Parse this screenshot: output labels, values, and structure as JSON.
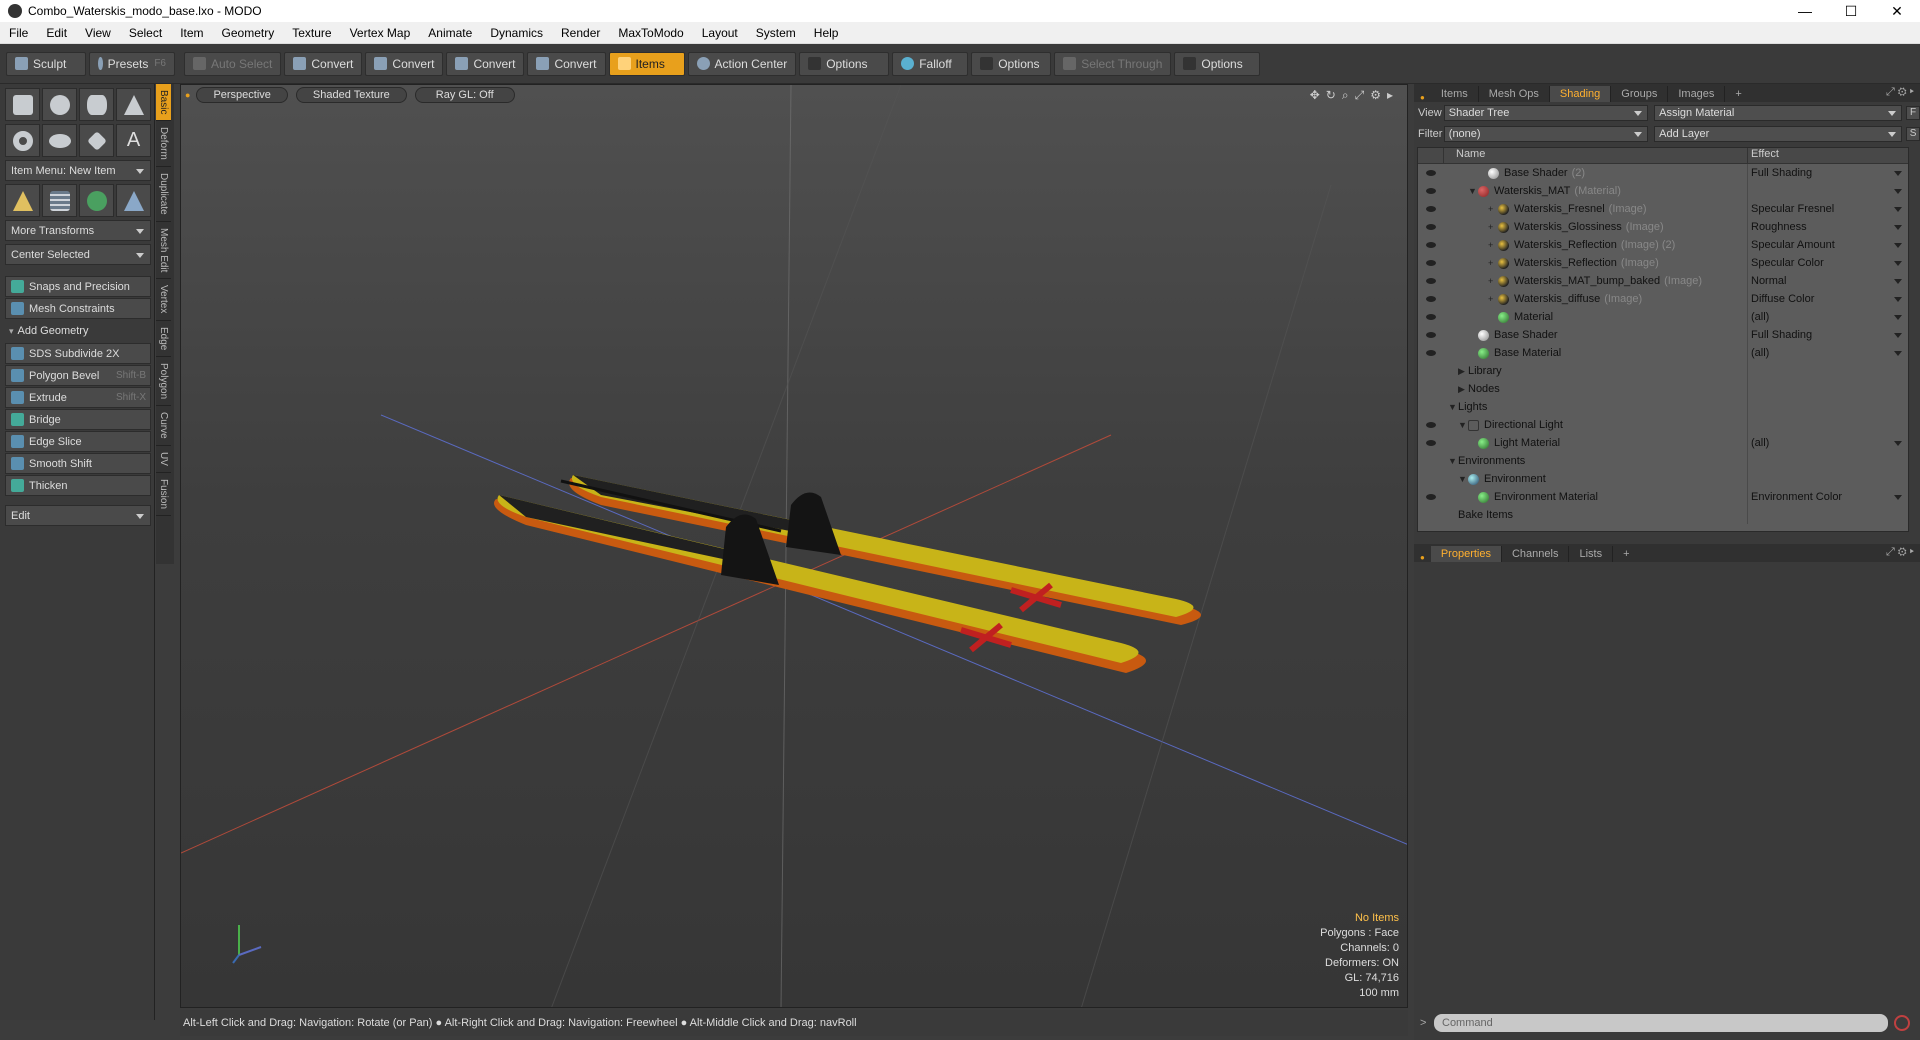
{
  "window": {
    "title": "Combo_Waterskis_modo_base.lxo - MODO",
    "min": "—",
    "max": "☐",
    "close": "✕"
  },
  "menu": [
    "File",
    "Edit",
    "View",
    "Select",
    "Item",
    "Geometry",
    "Texture",
    "Vertex Map",
    "Animate",
    "Dynamics",
    "Render",
    "MaxToModo",
    "Layout",
    "System",
    "Help"
  ],
  "toolbar": {
    "sculpt": "Sculpt",
    "presets": "Presets",
    "presets_key": "F6",
    "auto_select": "Auto Select",
    "convert": "Convert",
    "items": "Items",
    "action_center": "Action Center",
    "options": "Options",
    "falloff": "Falloff",
    "select_through": "Select Through"
  },
  "left": {
    "item_menu": "Item Menu: New Item",
    "more_transforms": "More Transforms",
    "center_selected": "Center Selected",
    "snaps": "Snaps and Precision",
    "mesh_constraints": "Mesh Constraints",
    "add_geometry": "Add Geometry",
    "tools": [
      {
        "label": "SDS Subdivide 2X",
        "key": ""
      },
      {
        "label": "Polygon Bevel",
        "key": "Shift-B"
      },
      {
        "label": "Extrude",
        "key": "Shift-X"
      },
      {
        "label": "Bridge",
        "key": ""
      },
      {
        "label": "Edge Slice",
        "key": ""
      },
      {
        "label": "Smooth Shift",
        "key": ""
      },
      {
        "label": "Thicken",
        "key": ""
      }
    ],
    "edit": "Edit"
  },
  "vtabs": [
    "Basic",
    "Deform",
    "Duplicate",
    "Mesh Edit",
    "Vertex",
    "Edge",
    "Polygon",
    "Curve",
    "UV",
    "Fusion"
  ],
  "viewport": {
    "view": "Perspective",
    "shading": "Shaded Texture",
    "raygl": "Ray GL: Off",
    "info": {
      "items": "No Items",
      "polygons": "Polygons : Face",
      "channels": "Channels: 0",
      "deformers": "Deformers: ON",
      "gl": "GL: 74,716",
      "scale": "100 mm"
    }
  },
  "status": "Alt-Left Click and Drag: Navigation: Rotate (or Pan) ● Alt-Right Click and Drag: Navigation: Freewheel ● Alt-Middle Click and Drag: navRoll",
  "right": {
    "tabs": [
      "Items",
      "Mesh Ops",
      "Shading",
      "Groups",
      "Images",
      "+"
    ],
    "view_label": "View",
    "view_value": "Shader Tree",
    "assign": "Assign Material",
    "f": "F",
    "filter_label": "Filter",
    "filter_value": "(none)",
    "add_layer": "Add Layer",
    "s": "S",
    "col_name": "Name",
    "col_effect": "Effect",
    "rows": [
      {
        "name": "Base Shader",
        "sub": "(2)",
        "effect": "Full Shading",
        "indent": 3,
        "icon": "shader",
        "eye": true,
        "dd": true,
        "tri": ""
      },
      {
        "name": "Waterskis_MAT",
        "sub": "(Material)",
        "effect": "",
        "indent": 2,
        "icon": "mat",
        "eye": true,
        "dd": true,
        "tri": "▼"
      },
      {
        "name": "Waterskis_Fresnel",
        "sub": "(Image)",
        "effect": "Specular Fresnel",
        "indent": 4,
        "icon": "img",
        "eye": true,
        "dd": true,
        "tri": "+"
      },
      {
        "name": "Waterskis_Glossiness",
        "sub": "(Image)",
        "effect": "Roughness",
        "indent": 4,
        "icon": "img",
        "eye": true,
        "dd": true,
        "tri": "+"
      },
      {
        "name": "Waterskis_Reflection",
        "sub": "(Image) (2)",
        "effect": "Specular Amount",
        "indent": 4,
        "icon": "img",
        "eye": true,
        "dd": true,
        "tri": "+"
      },
      {
        "name": "Waterskis_Reflection",
        "sub": "(Image)",
        "effect": "Specular Color",
        "indent": 4,
        "icon": "img",
        "eye": true,
        "dd": true,
        "tri": "+"
      },
      {
        "name": "Waterskis_MAT_bump_baked",
        "sub": "(Image)",
        "effect": "Normal",
        "indent": 4,
        "icon": "img",
        "eye": true,
        "dd": true,
        "tri": "+"
      },
      {
        "name": "Waterskis_diffuse",
        "sub": "(Image)",
        "effect": "Diffuse Color",
        "indent": 4,
        "icon": "img",
        "eye": true,
        "dd": true,
        "tri": "+"
      },
      {
        "name": "Material",
        "sub": "",
        "effect": "(all)",
        "indent": 4,
        "icon": "grn",
        "eye": true,
        "dd": true,
        "tri": ""
      },
      {
        "name": "Base Shader",
        "sub": "",
        "effect": "Full Shading",
        "indent": 2,
        "icon": "shader",
        "eye": true,
        "dd": true,
        "tri": ""
      },
      {
        "name": "Base Material",
        "sub": "",
        "effect": "(all)",
        "indent": 2,
        "icon": "grn",
        "eye": true,
        "dd": true,
        "tri": ""
      },
      {
        "name": "Library",
        "sub": "",
        "effect": "",
        "indent": 1,
        "icon": "",
        "eye": false,
        "dd": false,
        "tri": "▶"
      },
      {
        "name": "Nodes",
        "sub": "",
        "effect": "",
        "indent": 1,
        "icon": "",
        "eye": false,
        "dd": false,
        "tri": "▶"
      },
      {
        "name": "Lights",
        "sub": "",
        "effect": "",
        "indent": 0,
        "icon": "",
        "eye": false,
        "dd": false,
        "tri": "▼"
      },
      {
        "name": "Directional Light",
        "sub": "",
        "effect": "",
        "indent": 1,
        "icon": "light",
        "eye": true,
        "dd": false,
        "tri": "▼"
      },
      {
        "name": "Light Material",
        "sub": "",
        "effect": "(all)",
        "indent": 2,
        "icon": "grn",
        "eye": true,
        "dd": true,
        "tri": ""
      },
      {
        "name": "Environments",
        "sub": "",
        "effect": "",
        "indent": 0,
        "icon": "",
        "eye": false,
        "dd": false,
        "tri": "▼"
      },
      {
        "name": "Environment",
        "sub": "",
        "effect": "",
        "indent": 1,
        "icon": "env",
        "eye": false,
        "dd": false,
        "tri": "▼"
      },
      {
        "name": "Environment Material",
        "sub": "",
        "effect": "Environment Color",
        "indent": 2,
        "icon": "grn",
        "eye": true,
        "dd": true,
        "tri": ""
      },
      {
        "name": "Bake Items",
        "sub": "",
        "effect": "",
        "indent": 0,
        "icon": "",
        "eye": false,
        "dd": false,
        "tri": ""
      }
    ],
    "props_tabs": [
      "Properties",
      "Channels",
      "Lists",
      "+"
    ],
    "command_placeholder": "Command"
  }
}
